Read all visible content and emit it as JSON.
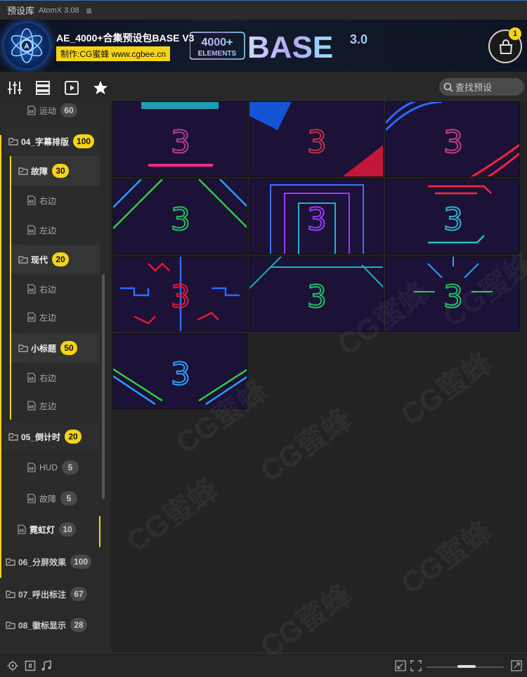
{
  "titlebar": {
    "name": "预设库",
    "version": "AtomX 3.08",
    "menu_glyph": "≡"
  },
  "banner": {
    "title": "AE_4000+合集预设包BASE V3",
    "credit": "制作:CG蜜蜂 www.cgbee.cn",
    "brand_top": "4000+",
    "brand_bottom": "ELEMENTS",
    "brand_word": "BASE",
    "brand_version": "3.0",
    "cart_badge": "1"
  },
  "toolbar": {
    "search_placeholder": "查找预设"
  },
  "sidebar": {
    "items": [
      {
        "label": "运动",
        "count": "60",
        "level": "l3"
      },
      {
        "label": "04_字幕排版",
        "count": "100",
        "level": "l1"
      },
      {
        "label": "故障",
        "count": "30",
        "level": "l2"
      },
      {
        "label": "右边",
        "count": "",
        "level": "l3"
      },
      {
        "label": "左边",
        "count": "",
        "level": "l3"
      },
      {
        "label": "现代",
        "count": "20",
        "level": "l2"
      },
      {
        "label": "右边",
        "count": "",
        "level": "l3"
      },
      {
        "label": "左边",
        "count": "",
        "level": "l3"
      },
      {
        "label": "小标题",
        "count": "50",
        "level": "l2"
      },
      {
        "label": "右边",
        "count": "",
        "level": "l3"
      },
      {
        "label": "左边",
        "count": "",
        "level": "l3"
      },
      {
        "label": "05_倒计时",
        "count": "20",
        "level": "l1"
      },
      {
        "label": "HUD",
        "count": "5",
        "level": "l3"
      },
      {
        "label": "故障",
        "count": "5",
        "level": "l3"
      },
      {
        "label": "霓虹灯",
        "count": "10",
        "level": "l3sel"
      },
      {
        "label": "06_分屏效果",
        "count": "100",
        "level": "cat"
      },
      {
        "label": "07_呼出标注",
        "count": "67",
        "level": "cat"
      },
      {
        "label": "08_徽标显示",
        "count": "28",
        "level": "cat"
      }
    ]
  },
  "grid": {
    "digit": "3"
  },
  "colors": {
    "accent": "#f5d417",
    "background": "#232323"
  },
  "watermark": "CG蜜蜂"
}
